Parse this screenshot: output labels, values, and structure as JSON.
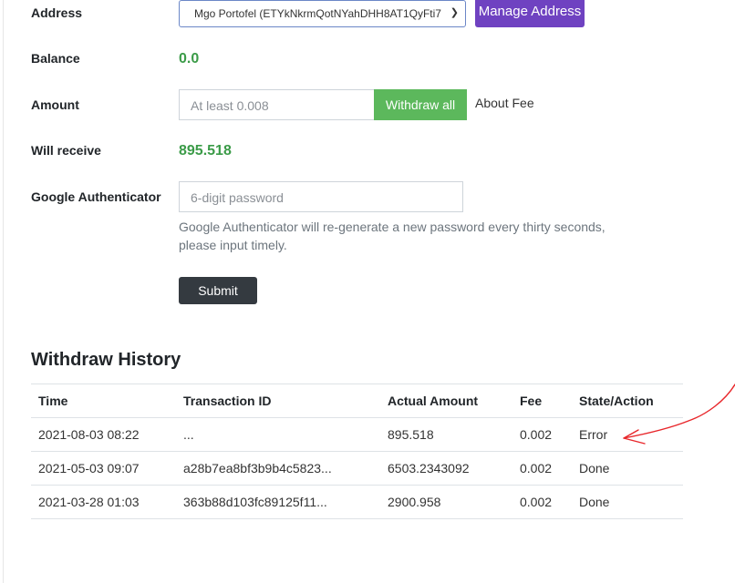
{
  "form": {
    "address_label": "Address",
    "address_value": "Mgo Portofel (ETYkNkrmQotNYahDHH8AT1QyFti7",
    "manage_address_label": "Manage Address",
    "balance_label": "Balance",
    "balance_value": "0.0",
    "amount_label": "Amount",
    "amount_placeholder": "At least 0.008",
    "withdraw_all_label": "Withdraw all",
    "about_fee_label": "About Fee",
    "will_receive_label": "Will receive",
    "will_receive_value": "895.518",
    "ga_label": "Google Authenticator",
    "ga_placeholder": "6-digit password",
    "ga_help": "Google Authenticator will re-generate a new password every thirty seconds, please input timely.",
    "submit_label": "Submit"
  },
  "history": {
    "title": "Withdraw History",
    "columns": [
      "Time",
      "Transaction ID",
      "Actual Amount",
      "Fee",
      "State/Action"
    ],
    "rows": [
      [
        "2021-08-03 08:22",
        "...",
        "895.518",
        "0.002",
        "Error"
      ],
      [
        "2021-05-03 09:07",
        "a28b7ea8bf3b9b4c5823...",
        "6503.2343092",
        "0.002",
        "Done"
      ],
      [
        "2021-03-28 01:03",
        "363b88d103fc89125f11...",
        "2900.958",
        "0.002",
        "Done"
      ]
    ]
  },
  "colors": {
    "accent_green": "#3b9b48",
    "manage_button": "#6f42c1",
    "withdraw_button": "#5cb85c",
    "submit_button": "#343a40",
    "annotation": "#e8262a"
  },
  "icons": {
    "select_caret": "chevron-down-icon"
  }
}
